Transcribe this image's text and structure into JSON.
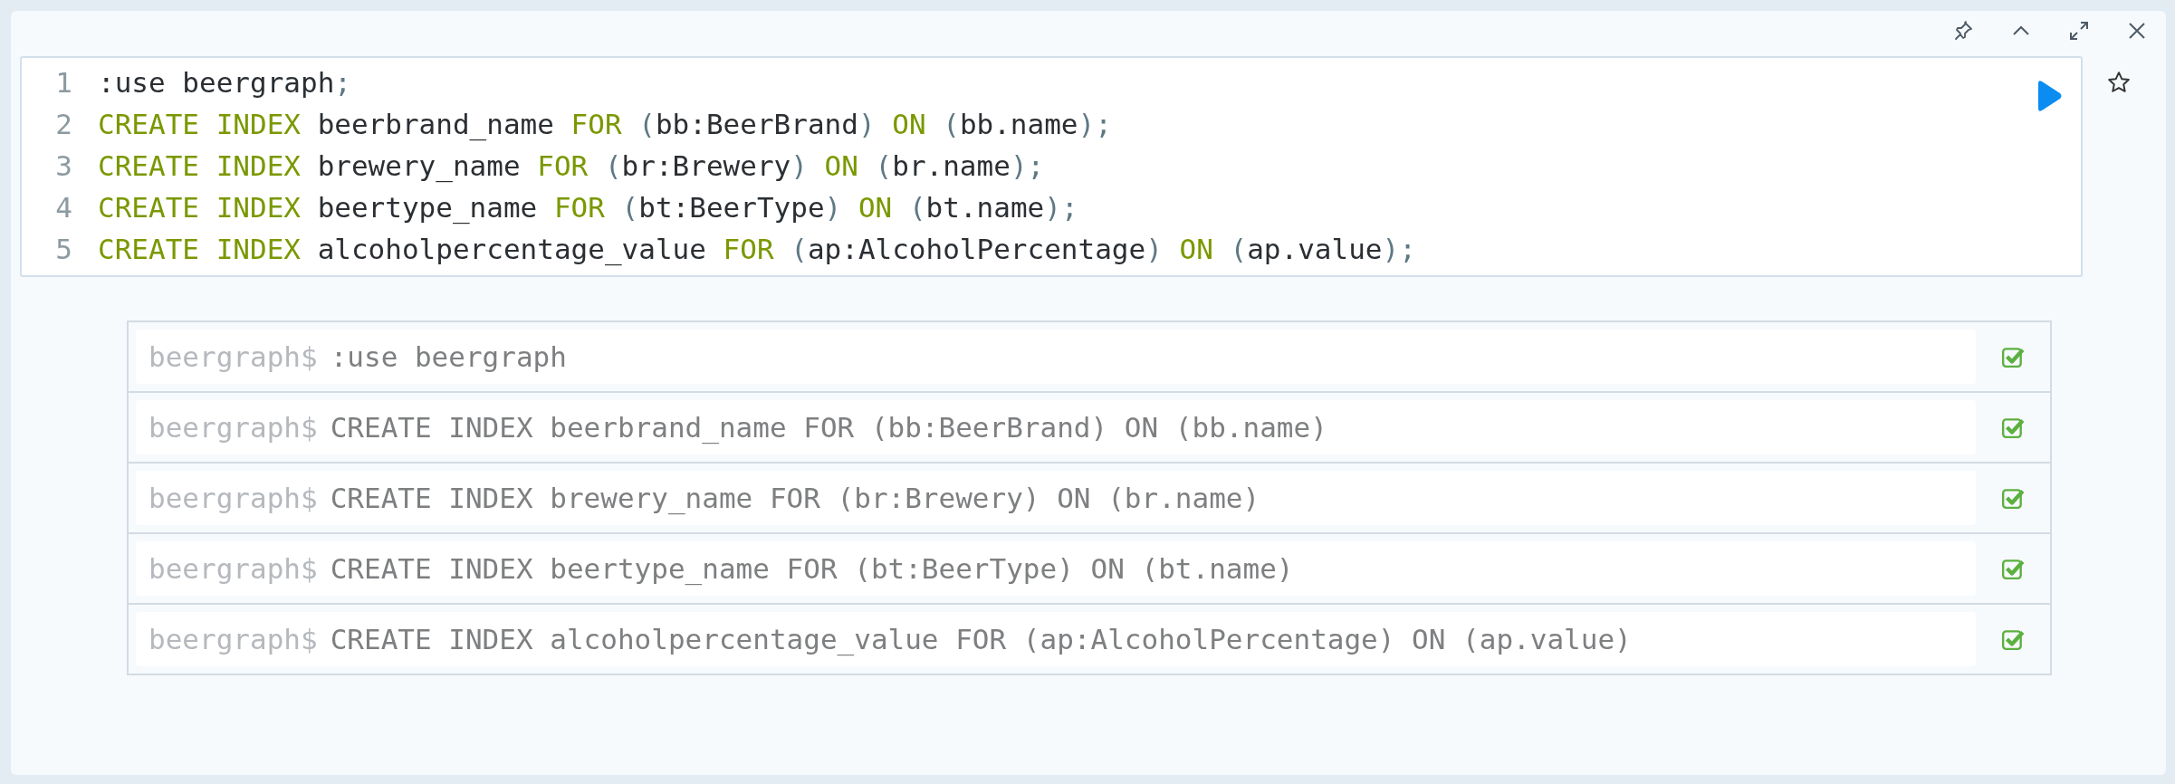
{
  "toolbar": {
    "buttons": [
      {
        "kind": "pin"
      },
      {
        "kind": "collapse"
      },
      {
        "kind": "expand"
      },
      {
        "kind": "close"
      }
    ]
  },
  "editor": {
    "lines": [
      {
        "number": "1",
        "tokens": [
          {
            "kind": "plain",
            "text": ":use beergraph"
          },
          {
            "kind": "punct",
            "text": ";"
          }
        ]
      },
      {
        "number": "2",
        "tokens": [
          {
            "kind": "keyword",
            "text": "CREATE INDEX"
          },
          {
            "kind": "plain",
            "text": " beerbrand_name "
          },
          {
            "kind": "keyword",
            "text": "FOR"
          },
          {
            "kind": "punct",
            "text": " ("
          },
          {
            "kind": "plain",
            "text": "bb:BeerBrand"
          },
          {
            "kind": "punct",
            "text": ") "
          },
          {
            "kind": "keyword",
            "text": "ON"
          },
          {
            "kind": "punct",
            "text": " ("
          },
          {
            "kind": "plain",
            "text": "bb.name"
          },
          {
            "kind": "punct",
            "text": ");"
          }
        ]
      },
      {
        "number": "3",
        "tokens": [
          {
            "kind": "keyword",
            "text": "CREATE INDEX"
          },
          {
            "kind": "plain",
            "text": " brewery_name "
          },
          {
            "kind": "keyword",
            "text": "FOR"
          },
          {
            "kind": "punct",
            "text": " ("
          },
          {
            "kind": "plain",
            "text": "br:Brewery"
          },
          {
            "kind": "punct",
            "text": ") "
          },
          {
            "kind": "keyword",
            "text": "ON"
          },
          {
            "kind": "punct",
            "text": " ("
          },
          {
            "kind": "plain",
            "text": "br.name"
          },
          {
            "kind": "punct",
            "text": ");"
          }
        ]
      },
      {
        "number": "4",
        "tokens": [
          {
            "kind": "keyword",
            "text": "CREATE INDEX"
          },
          {
            "kind": "plain",
            "text": " beertype_name "
          },
          {
            "kind": "keyword",
            "text": "FOR"
          },
          {
            "kind": "punct",
            "text": " ("
          },
          {
            "kind": "plain",
            "text": "bt:BeerType"
          },
          {
            "kind": "punct",
            "text": ") "
          },
          {
            "kind": "keyword",
            "text": "ON"
          },
          {
            "kind": "punct",
            "text": " ("
          },
          {
            "kind": "plain",
            "text": "bt.name"
          },
          {
            "kind": "punct",
            "text": ");"
          }
        ]
      },
      {
        "number": "5",
        "tokens": [
          {
            "kind": "keyword",
            "text": "CREATE INDEX"
          },
          {
            "kind": "plain",
            "text": " alcoholpercentage_value "
          },
          {
            "kind": "keyword",
            "text": "FOR"
          },
          {
            "kind": "punct",
            "text": " ("
          },
          {
            "kind": "plain",
            "text": "ap:AlcoholPercentage"
          },
          {
            "kind": "punct",
            "text": ") "
          },
          {
            "kind": "keyword",
            "text": "ON"
          },
          {
            "kind": "punct",
            "text": " ("
          },
          {
            "kind": "plain",
            "text": "ap.value"
          },
          {
            "kind": "punct",
            "text": ");"
          }
        ]
      }
    ]
  },
  "results": [
    {
      "prompt": "beergraph$",
      "command": ":use beergraph",
      "kind": "success"
    },
    {
      "prompt": "beergraph$",
      "command": "CREATE INDEX beerbrand_name FOR (bb:BeerBrand) ON (bb.name)",
      "kind": "success"
    },
    {
      "prompt": "beergraph$",
      "command": "CREATE INDEX brewery_name FOR (br:Brewery) ON (br.name)",
      "kind": "success"
    },
    {
      "prompt": "beergraph$",
      "command": "CREATE INDEX beertype_name FOR (bt:BeerType) ON (bt.name)",
      "kind": "success"
    },
    {
      "prompt": "beergraph$",
      "command": "CREATE INDEX alcoholpercentage_value FOR (ap:AlcoholPercentage) ON (ap.value)",
      "kind": "success"
    }
  ]
}
